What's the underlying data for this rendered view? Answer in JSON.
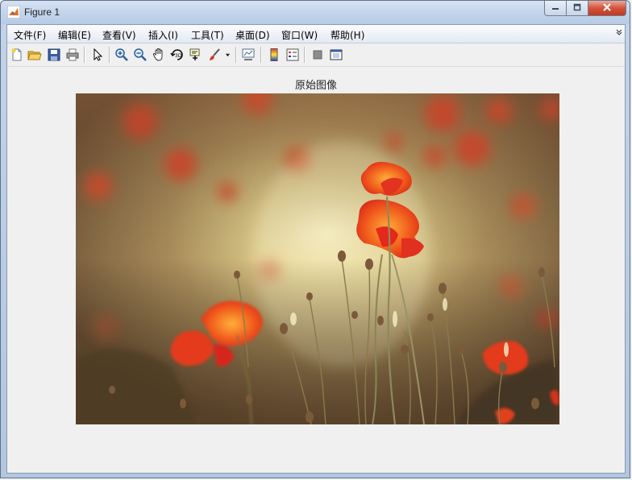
{
  "window": {
    "title": "Figure 1",
    "icons": {
      "app": "matlab-logo-icon",
      "minimize": "minimize-icon",
      "maximize": "maximize-icon",
      "close": "close-icon"
    }
  },
  "menubar": {
    "items": [
      {
        "label": "文件(F)"
      },
      {
        "label": "编辑(E)"
      },
      {
        "label": "查看(V)"
      },
      {
        "label": "插入(I)"
      },
      {
        "label": "工具(T)"
      },
      {
        "label": "桌面(D)"
      },
      {
        "label": "窗口(W)"
      },
      {
        "label": "帮助(H)"
      }
    ],
    "overflow_icon": "chevron-icon"
  },
  "toolbar": {
    "buttons": [
      "new-figure-icon",
      "open-file-icon",
      "save-icon",
      "print-icon",
      "edit-plot-icon",
      "zoom-in-icon",
      "zoom-out-icon",
      "pan-icon",
      "rotate-3d-icon",
      "data-cursor-icon",
      "brush-icon",
      "link-plot-icon",
      "insert-colorbar-icon",
      "insert-legend-icon",
      "hide-plot-tools-icon",
      "show-plot-tools-icon"
    ]
  },
  "figure": {
    "axes_title": "原始图像",
    "image": "poppy-flowers-photo"
  },
  "colors": {
    "close_button": "#c74b34",
    "flower_red": "#e8391f",
    "flower_orange": "#f07a1c"
  }
}
